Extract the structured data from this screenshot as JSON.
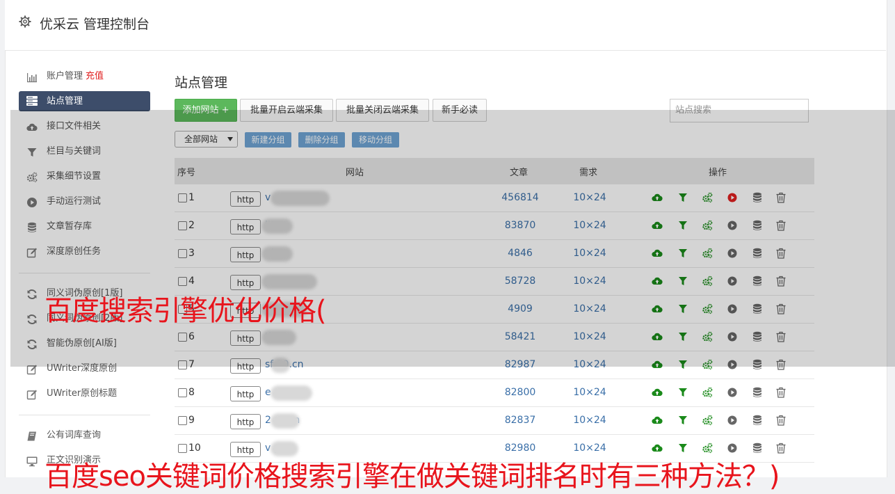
{
  "header": {
    "title": "优采云 管理控制台"
  },
  "sidebar": {
    "items": [
      {
        "label": "账户管理",
        "icon": "bar-chart-icon",
        "extra": "充值"
      },
      {
        "label": "站点管理",
        "icon": "server-list-icon",
        "active": true
      },
      {
        "label": "接口文件相关",
        "icon": "cloud-upload-icon"
      },
      {
        "label": "栏目与关键词",
        "icon": "filter-icon"
      },
      {
        "label": "采集细节设置",
        "icon": "gears-icon"
      },
      {
        "label": "手动运行测试",
        "icon": "play-circle-icon"
      },
      {
        "label": "文章暂存库",
        "icon": "database-icon"
      },
      {
        "label": "深度原创任务",
        "icon": "edit-icon"
      },
      {
        "label": "同义词伪原创[1版]",
        "icon": "refresh-icon"
      },
      {
        "label": "同义词伪原创[2版]",
        "icon": "refresh-icon"
      },
      {
        "label": "智能伪原创[AI版]",
        "icon": "refresh-icon"
      },
      {
        "label": "UWriter深度原创",
        "icon": "edit-icon"
      },
      {
        "label": "UWriter原创标题",
        "icon": "edit-icon"
      },
      {
        "label": "公有词库查询",
        "icon": "book-icon"
      },
      {
        "label": "正文识别演示",
        "icon": "monitor-icon"
      }
    ]
  },
  "main": {
    "title": "站点管理",
    "buttons": {
      "add_site": "添加网站 +",
      "batch_open": "批量开启云端采集",
      "batch_close": "批量关闭云端采集",
      "newbie": "新手必读"
    },
    "search_placeholder": "站点搜索",
    "group_select": "全部网站",
    "group_buttons": {
      "new": "新建分组",
      "delete": "删除分组",
      "move": "移动分组"
    },
    "table": {
      "headers": {
        "no": "序号",
        "site": "网站",
        "articles": "文章",
        "demand": "需求",
        "ops": "操作"
      },
      "rows": [
        {
          "no": "1",
          "proto": "http",
          "site": "v          .com",
          "articles": "456814",
          "demand": "10×24",
          "running": true
        },
        {
          "no": "2",
          "proto": "http",
          "site": "      lit.cn",
          "articles": "83870",
          "demand": "10×24",
          "running": false
        },
        {
          "no": "3",
          "proto": "http",
          "site": "      ni.cn",
          "articles": "4846",
          "demand": "10×24",
          "running": false
        },
        {
          "no": "4",
          "proto": "http",
          "site": "        pay.cn",
          "articles": "58728",
          "demand": "10×24",
          "running": false
        },
        {
          "no": "5",
          "proto": "http",
          "site": "        ag.cn",
          "articles": "4909",
          "demand": "10×24",
          "running": false
        },
        {
          "no": "6",
          "proto": "http",
          "site": "      tk.cn",
          "articles": "58421",
          "demand": "10×24",
          "running": false
        },
        {
          "no": "7",
          "proto": "http",
          "site": "sf  29.cn",
          "articles": "82987",
          "demand": "10×24",
          "running": false
        },
        {
          "no": "8",
          "proto": "http",
          "site": "e      ay.cn",
          "articles": "82800",
          "demand": "10×24",
          "running": false
        },
        {
          "no": "9",
          "proto": "http",
          "site": "2      az.cn",
          "articles": "82837",
          "demand": "10×24",
          "running": false
        },
        {
          "no": "10",
          "proto": "http",
          "site": "v      p.cn",
          "articles": "82980",
          "demand": "10×24",
          "running": false
        }
      ]
    }
  },
  "overlay_text": {
    "line1": "百度搜索引擎优化价格(",
    "line2": "百度seo关键词价格搜索引擎在做关键词排名时有三种方法？)"
  },
  "colors": {
    "active_nav": "#3d4d6a",
    "link": "#3a6fa8",
    "green": "#1a8a1a",
    "red": "#e02020",
    "overlay_text": "#e8141c"
  }
}
